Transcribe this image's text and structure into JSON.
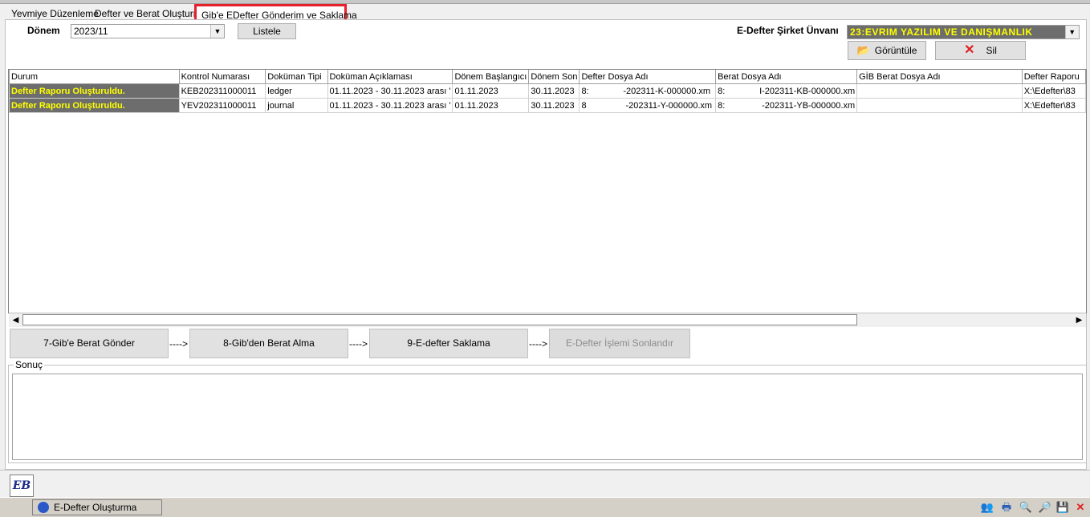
{
  "tabs": [
    "Yevmiye Düzenleme",
    "Defter ve Berat Oluşturma",
    "Gib'e EDefter Gönderim ve Saklama"
  ],
  "donem": {
    "label": "Dönem",
    "value": "2023/11",
    "list_button": "Listele"
  },
  "company": {
    "label": "E-Defter Şirket Ünvanı",
    "value": "23:EVRIM YAZILIM VE DANIŞMANLIK"
  },
  "buttons": {
    "view": "Görüntüle",
    "delete": "Sil"
  },
  "grid": {
    "columns": [
      "Durum",
      "Kontrol Numarası",
      "Doküman Tipi",
      "Doküman Açıklaması",
      "Dönem Başlangıcı",
      "Dönem Son",
      "Defter Dosya Adı",
      "Berat Dosya Adı",
      "GİB Berat Dosya Adı",
      "Defter Raporu"
    ],
    "rows": [
      [
        "Defter Raporu Oluşturuldu.",
        "KEB202311000011",
        "ledger",
        "01.11.2023 - 30.11.2023 arası '",
        "01.11.2023",
        "30.11.2023",
        "8:              -202311-K-000000.xm",
        "8:              I-202311-KB-000000.xm",
        "",
        "X:\\Edefter\\83"
      ],
      [
        "Defter Raporu Oluşturuldu.",
        "YEV202311000011",
        "journal",
        "01.11.2023 - 30.11.2023 arası '",
        "01.11.2023",
        "30.11.2023",
        "8                -202311-Y-000000.xm",
        "8:               -202311-YB-000000.xm",
        "",
        "X:\\Edefter\\83"
      ]
    ]
  },
  "steps": [
    "7-Gib'e Berat Gönder",
    "8-Gib'den Berat Alma",
    "9-E-defter Saklama",
    "E-Defter İşlemi Sonlandır"
  ],
  "step_arrow": "---->",
  "sonuc_label": "Sonuç",
  "logo_text": "EB",
  "taskbar": {
    "item": "E-Defter Oluşturma"
  },
  "colors": {
    "status_bg": "#6d6d6d",
    "status_text": "#ffff00",
    "company_bg": "#6d6d6d",
    "company_text": "#ffff00",
    "highlight": "#e8202a"
  }
}
